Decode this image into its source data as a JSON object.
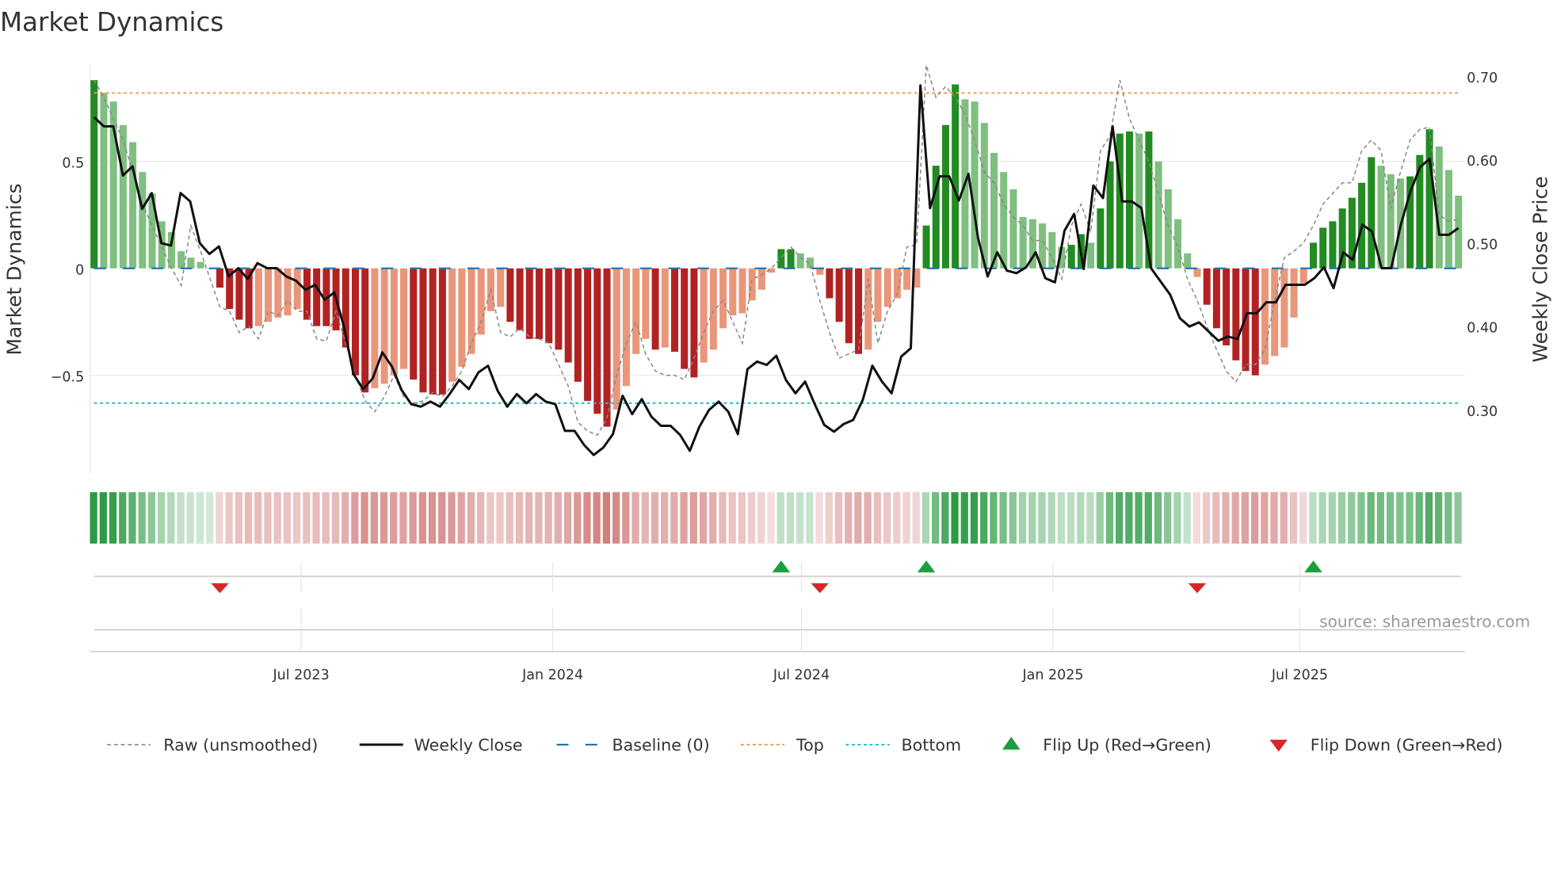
{
  "chart_data": {
    "type": "bar",
    "title": "Market Dynamics",
    "ylabel": "Market Dynamics",
    "y2label": "Weekly Close Price",
    "ylim": [
      -0.97,
      0.97
    ],
    "y2lim": [
      0.22,
      0.717
    ],
    "yticks": [
      {
        "value": 0.5,
        "label": "0.5"
      },
      {
        "value": 0,
        "label": "0"
      },
      {
        "value": -0.5,
        "label": "−0.5"
      }
    ],
    "y2ticks": [
      {
        "value": 0.7,
        "label": "0.70"
      },
      {
        "value": 0.6,
        "label": "0.60"
      },
      {
        "value": 0.5,
        "label": "0.50"
      },
      {
        "value": 0.4,
        "label": "0.40"
      },
      {
        "value": 0.3,
        "label": "0.30"
      }
    ],
    "x_ticks": [
      {
        "label": "Jul 2023",
        "week": 21.4
      },
      {
        "label": "Jan 2024",
        "week": 47.4
      },
      {
        "label": "Jul 2024",
        "week": 73.1
      },
      {
        "label": "Jan 2025",
        "week": 99.1
      },
      {
        "label": "Jul 2025",
        "week": 124.6
      }
    ],
    "top_level": 0.82,
    "bottom_level": -0.63,
    "baseline": 0,
    "momentum": [
      0.88,
      0.82,
      0.78,
      0.67,
      0.59,
      0.45,
      0.35,
      0.22,
      0.17,
      0.08,
      0.05,
      0.03,
      0.0,
      -0.09,
      -0.19,
      -0.24,
      -0.28,
      -0.27,
      -0.25,
      -0.23,
      -0.22,
      -0.19,
      -0.24,
      -0.27,
      -0.27,
      -0.29,
      -0.37,
      -0.5,
      -0.58,
      -0.56,
      -0.54,
      -0.5,
      -0.47,
      -0.52,
      -0.58,
      -0.59,
      -0.59,
      -0.53,
      -0.46,
      -0.4,
      -0.31,
      -0.2,
      -0.18,
      -0.25,
      -0.29,
      -0.33,
      -0.33,
      -0.35,
      -0.38,
      -0.44,
      -0.53,
      -0.62,
      -0.68,
      -0.74,
      -0.66,
      -0.55,
      -0.4,
      -0.33,
      -0.38,
      -0.37,
      -0.39,
      -0.47,
      -0.51,
      -0.44,
      -0.38,
      -0.28,
      -0.22,
      -0.21,
      -0.15,
      -0.1,
      -0.02,
      0.09,
      0.09,
      0.07,
      0.05,
      -0.03,
      -0.14,
      -0.25,
      -0.35,
      -0.4,
      -0.38,
      -0.25,
      -0.18,
      -0.14,
      -0.1,
      -0.09,
      0.2,
      0.48,
      0.67,
      0.86,
      0.79,
      0.78,
      0.68,
      0.54,
      0.45,
      0.37,
      0.24,
      0.23,
      0.21,
      0.17,
      0.1,
      0.11,
      0.16,
      0.12,
      0.28,
      0.5,
      0.63,
      0.64,
      0.63,
      0.64,
      0.5,
      0.37,
      0.23,
      0.07,
      -0.04,
      -0.17,
      -0.28,
      -0.36,
      -0.43,
      -0.48,
      -0.5,
      -0.45,
      -0.41,
      -0.37,
      -0.23,
      -0.07,
      0.12,
      0.19,
      0.22,
      0.28,
      0.33,
      0.4,
      0.52,
      0.48,
      0.44,
      0.42,
      0.43,
      0.53,
      0.65,
      0.57,
      0.46,
      0.34
    ],
    "raw": [
      0.88,
      0.8,
      0.7,
      0.6,
      0.45,
      0.3,
      0.2,
      0.1,
      0.0,
      -0.08,
      0.2,
      0.08,
      -0.05,
      -0.18,
      -0.2,
      -0.3,
      -0.27,
      -0.33,
      -0.2,
      -0.22,
      -0.15,
      -0.2,
      -0.2,
      -0.33,
      -0.34,
      -0.2,
      -0.35,
      -0.5,
      -0.62,
      -0.67,
      -0.6,
      -0.5,
      -0.6,
      -0.63,
      -0.62,
      -0.58,
      -0.6,
      -0.55,
      -0.48,
      -0.35,
      -0.25,
      -0.1,
      -0.3,
      -0.32,
      -0.28,
      -0.32,
      -0.33,
      -0.35,
      -0.45,
      -0.55,
      -0.72,
      -0.76,
      -0.78,
      -0.7,
      -0.5,
      -0.35,
      -0.25,
      -0.4,
      -0.48,
      -0.5,
      -0.5,
      -0.52,
      -0.42,
      -0.3,
      -0.2,
      -0.15,
      -0.25,
      -0.35,
      -0.05,
      -0.03,
      0.0,
      0.05,
      0.1,
      0.05,
      0.02,
      -0.15,
      -0.3,
      -0.42,
      -0.4,
      -0.38,
      -0.05,
      -0.35,
      -0.2,
      -0.12,
      0.1,
      0.11,
      0.95,
      0.8,
      0.85,
      0.8,
      0.72,
      0.6,
      0.45,
      0.4,
      0.3,
      0.24,
      0.2,
      0.13,
      0.13,
      0.05,
      -0.05,
      0.2,
      0.3,
      0.17,
      0.55,
      0.62,
      0.88,
      0.7,
      0.6,
      0.5,
      0.35,
      0.2,
      0.1,
      -0.05,
      -0.15,
      -0.27,
      -0.38,
      -0.48,
      -0.53,
      -0.45,
      -0.45,
      -0.38,
      -0.15,
      0.05,
      0.08,
      0.12,
      0.2,
      0.3,
      0.35,
      0.4,
      0.4,
      0.55,
      0.6,
      0.55,
      0.28,
      0.45,
      0.6,
      0.65,
      0.66,
      0.25,
      0.22,
      0.23
    ],
    "weekly_close": [
      0.651,
      0.64,
      0.64,
      0.581,
      0.592,
      0.541,
      0.56,
      0.5,
      0.497,
      0.56,
      0.55,
      0.5,
      0.487,
      0.496,
      0.46,
      0.47,
      0.457,
      0.476,
      0.47,
      0.47,
      0.46,
      0.455,
      0.444,
      0.45,
      0.432,
      0.441,
      0.4,
      0.343,
      0.325,
      0.338,
      0.369,
      0.352,
      0.324,
      0.307,
      0.304,
      0.31,
      0.304,
      0.319,
      0.336,
      0.325,
      0.345,
      0.353,
      0.323,
      0.304,
      0.319,
      0.308,
      0.319,
      0.31,
      0.307,
      0.275,
      0.275,
      0.258,
      0.246,
      0.255,
      0.271,
      0.317,
      0.295,
      0.313,
      0.292,
      0.281,
      0.281,
      0.27,
      0.251,
      0.28,
      0.3,
      0.31,
      0.298,
      0.271,
      0.349,
      0.358,
      0.354,
      0.365,
      0.336,
      0.32,
      0.334,
      0.307,
      0.282,
      0.274,
      0.283,
      0.288,
      0.312,
      0.353,
      0.334,
      0.32,
      0.364,
      0.374,
      0.689,
      0.542,
      0.58,
      0.58,
      0.551,
      0.583,
      0.506,
      0.46,
      0.489,
      0.467,
      0.464,
      0.471,
      0.489,
      0.458,
      0.453,
      0.515,
      0.535,
      0.469,
      0.569,
      0.554,
      0.64,
      0.55,
      0.55,
      0.542,
      0.47,
      0.454,
      0.438,
      0.41,
      0.4,
      0.405,
      0.394,
      0.383,
      0.388,
      0.385,
      0.416,
      0.416,
      0.429,
      0.429,
      0.45,
      0.45,
      0.45,
      0.458,
      0.471,
      0.446,
      0.489,
      0.48,
      0.522,
      0.514,
      0.47,
      0.47,
      0.522,
      0.562,
      0.591,
      0.601,
      0.51,
      0.51,
      0.518
    ],
    "flips": [
      {
        "type": "down",
        "week": 13
      },
      {
        "type": "up",
        "week": 71
      },
      {
        "type": "down",
        "week": 75
      },
      {
        "type": "up",
        "week": 86
      },
      {
        "type": "down",
        "week": 114
      },
      {
        "type": "up",
        "week": 126
      }
    ],
    "legend": [
      {
        "key": "raw",
        "label": "Raw (unsmoothed)"
      },
      {
        "key": "close",
        "label": "Weekly Close"
      },
      {
        "key": "baseline",
        "label": "Baseline (0)"
      },
      {
        "key": "top",
        "label": "Top"
      },
      {
        "key": "bottom",
        "label": "Bottom"
      },
      {
        "key": "flip_up",
        "label": "Flip Up (Red→Green)"
      },
      {
        "key": "flip_down",
        "label": "Flip Down (Green→Red)"
      }
    ],
    "source": "source: sharemaestro.com",
    "colors": {
      "green_strong": "#228b22",
      "green_weak": "#7fbf7f",
      "red_strong": "#b22222",
      "red_weak": "#e9967a",
      "top": "#f0a050",
      "bottom": "#20c0d0",
      "baseline": "#1f77b4",
      "close": "#111111",
      "raw": "#888888",
      "flip_up": "#1a9e3f",
      "flip_down": "#d62728"
    }
  }
}
